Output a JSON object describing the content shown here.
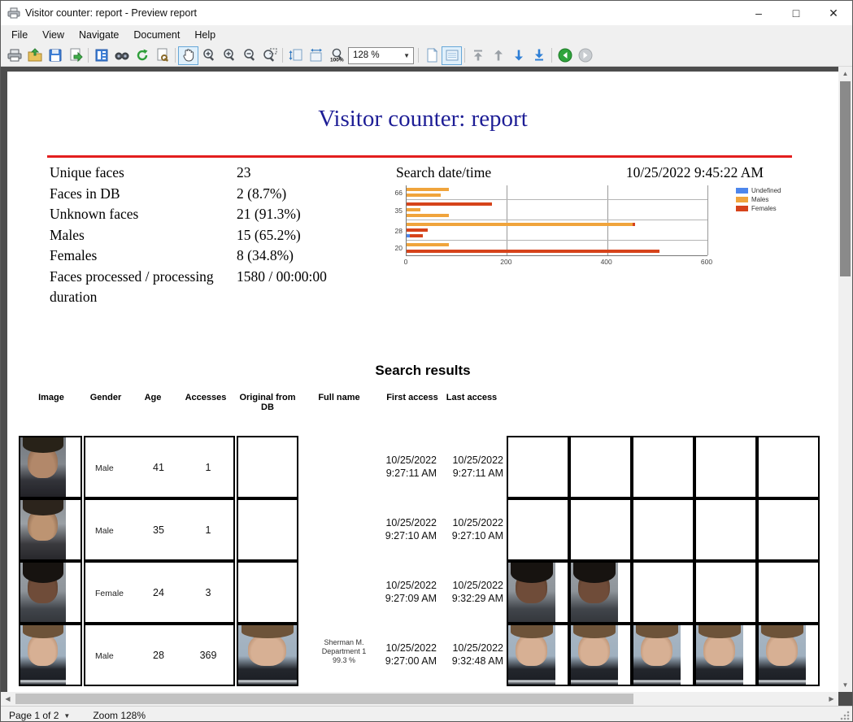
{
  "window": {
    "title": "Visitor counter: report - Preview report"
  },
  "menu": {
    "items": [
      "File",
      "View",
      "Navigate",
      "Document",
      "Help"
    ]
  },
  "toolbar": {
    "zoom_value": "128 %"
  },
  "report": {
    "title": "Visitor counter: report",
    "stats": [
      {
        "label": "Unique faces",
        "value": "23"
      },
      {
        "label": "Faces in DB",
        "value": "2 (8.7%)"
      },
      {
        "label": "Unknown faces",
        "value": "21 (91.3%)"
      },
      {
        "label": "Males",
        "value": "15 (65.2%)"
      },
      {
        "label": "Females",
        "value": "8 (34.8%)"
      },
      {
        "label": "Faces processed / processing duration",
        "value": "1580 / 00:00:00"
      }
    ],
    "search_label": "Search date/time",
    "search_value": "10/25/2022 9:45:22 AM",
    "results_title": "Search results"
  },
  "chart_data": {
    "type": "bar",
    "orientation": "horizontal",
    "xlim": [
      0,
      600
    ],
    "x_ticks": [
      "0",
      "200",
      "400",
      "600"
    ],
    "legend": [
      "Undefined",
      "Males",
      "Females"
    ],
    "legend_position": "right",
    "colors": {
      "Undefined": "#4d86ec",
      "Males": "#f0a43c",
      "Females": "#d6431b"
    },
    "groups": [
      {
        "label": "66",
        "bars": [
          [
            {
              "series": "Males",
              "value": 85
            }
          ],
          [
            {
              "series": "Males",
              "value": 68
            }
          ]
        ]
      },
      {
        "label": "35",
        "bars": [
          [
            {
              "series": "Females",
              "value": 170
            }
          ],
          [
            {
              "series": "Males",
              "value": 28
            }
          ],
          [
            {
              "series": "Males",
              "value": 85
            }
          ]
        ]
      },
      {
        "label": "28",
        "bars": [
          [
            {
              "series": "Females",
              "value": 455
            },
            {
              "series": "Males",
              "value": 450
            }
          ],
          [
            {
              "series": "Females",
              "value": 42
            }
          ],
          [
            {
              "series": "Females",
              "value": 33
            },
            {
              "series": "Undefined",
              "value": 6
            }
          ]
        ]
      },
      {
        "label": "20",
        "bars": [
          [
            {
              "series": "Males",
              "value": 85
            }
          ],
          [
            {
              "series": "Females",
              "value": 505
            }
          ]
        ]
      }
    ]
  },
  "table": {
    "headers": [
      "Image",
      "Gender",
      "Age",
      "Accesses",
      "Original from DB",
      "Full name",
      "First access",
      "Last access"
    ],
    "rows": [
      {
        "photo": "a",
        "gender": "Male",
        "age": "41",
        "accesses": "1",
        "db_image": false,
        "full_name": [],
        "first_date": "10/25/2022",
        "first_time": "9:27:11 AM",
        "last_date": "10/25/2022",
        "last_time": "9:27:11 AM",
        "grid_images": 0
      },
      {
        "photo": "b",
        "gender": "Male",
        "age": "35",
        "accesses": "1",
        "db_image": false,
        "full_name": [],
        "first_date": "10/25/2022",
        "first_time": "9:27:10 AM",
        "last_date": "10/25/2022",
        "last_time": "9:27:10 AM",
        "grid_images": 0
      },
      {
        "photo": "c",
        "gender": "Female",
        "age": "24",
        "accesses": "3",
        "db_image": false,
        "full_name": [],
        "first_date": "10/25/2022",
        "first_time": "9:27:09 AM",
        "last_date": "10/25/2022",
        "last_time": "9:32:29 AM",
        "grid_images": 2
      },
      {
        "photo": "d",
        "gender": "Male",
        "age": "28",
        "accesses": "369",
        "db_image": true,
        "full_name": [
          "Sherman M.",
          "Department 1",
          "99.3 %"
        ],
        "first_date": "10/25/2022",
        "first_time": "9:27:00 AM",
        "last_date": "10/25/2022",
        "last_time": "9:32:48 AM",
        "grid_images": 5
      }
    ]
  },
  "status": {
    "page_label": "Page 1 of 2",
    "zoom_label": "Zoom 128%"
  }
}
